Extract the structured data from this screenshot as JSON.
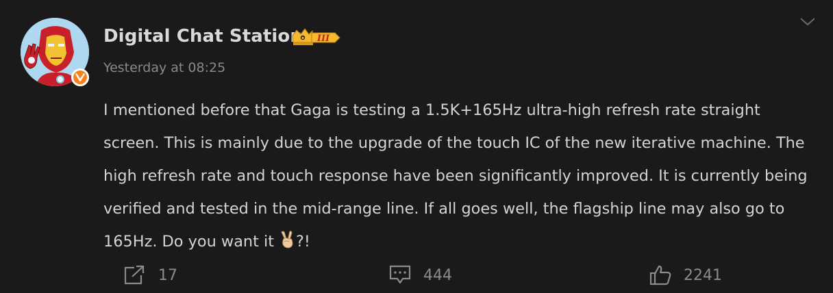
{
  "post": {
    "author": {
      "name": "Digital Chat Station",
      "badge_label": "III",
      "verified_icon": "verified-v-icon"
    },
    "timestamp": "Yesterday at 08:25",
    "content": "I mentioned before that Gaga is testing a 1.5K+165Hz ultra-high refresh rate straight screen. This is mainly due to the upgrade of the touch IC of the new iterative machine. The high refresh rate and touch response have been significantly improved. It is currently being verified and tested in the mid-range line. If all goes well, the flagship line may also go to 165Hz. Do you want it",
    "content_suffix": "?!",
    "emoji": "victory-hand-emoji"
  },
  "actions": {
    "share": {
      "icon": "share-icon",
      "count": "17"
    },
    "comment": {
      "icon": "comment-icon",
      "count": "444"
    },
    "like": {
      "icon": "thumbs-up-icon",
      "count": "2241"
    }
  },
  "menu": {
    "icon": "chevron-down-icon"
  },
  "colors": {
    "background": "#1a1a1a",
    "username": "#d9d9d9",
    "body_text": "#d4d4d4",
    "muted": "#8a8a8a",
    "verified": "#f6821f",
    "crown_gold": "#f5b82e"
  }
}
